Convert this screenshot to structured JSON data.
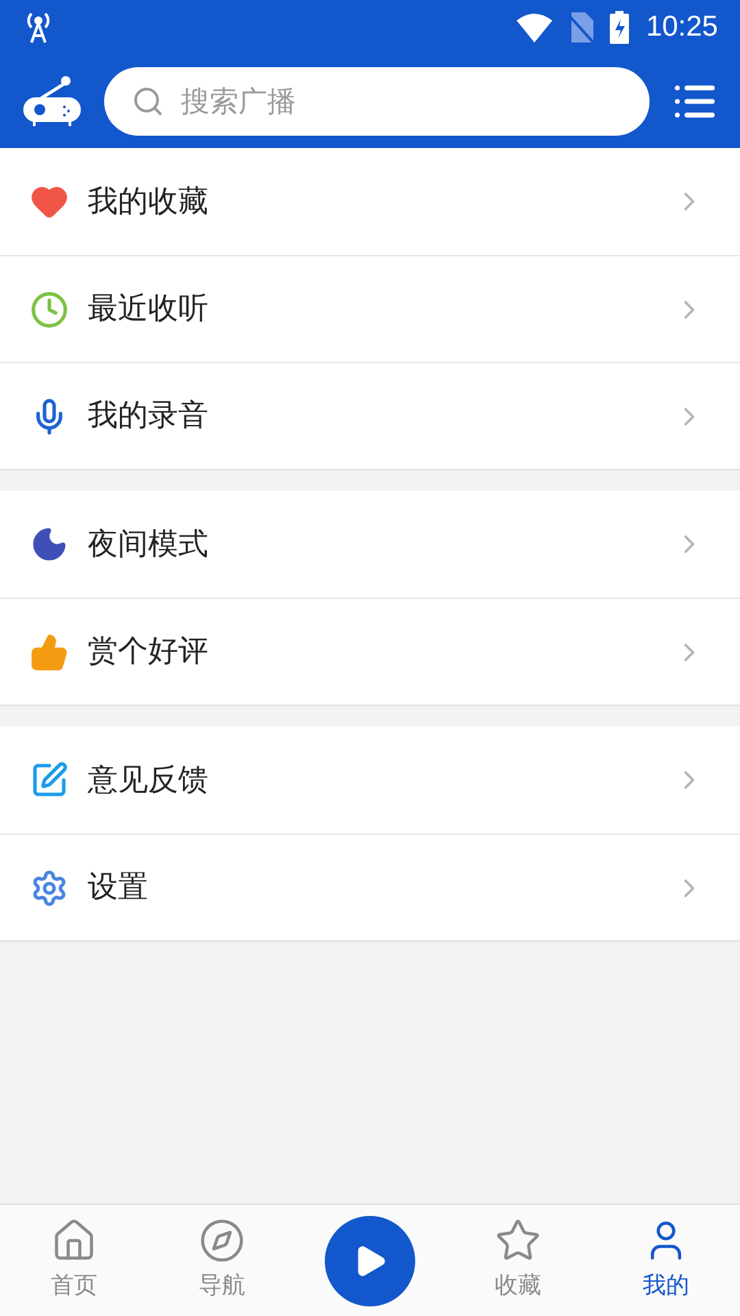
{
  "status_bar": {
    "time": "10:25"
  },
  "search": {
    "placeholder": "搜索广播"
  },
  "menu_groups": [
    {
      "items": [
        {
          "label": "我的收藏"
        },
        {
          "label": "最近收听"
        },
        {
          "label": "我的录音"
        }
      ]
    },
    {
      "items": [
        {
          "label": "夜间模式"
        },
        {
          "label": "赏个好评"
        }
      ]
    },
    {
      "items": [
        {
          "label": "意见反馈"
        },
        {
          "label": "设置"
        }
      ]
    }
  ],
  "bottom_nav": [
    {
      "kind": "tab",
      "label": "首页",
      "selected": false
    },
    {
      "kind": "tab",
      "label": "导航",
      "selected": false
    },
    {
      "kind": "play"
    },
    {
      "kind": "tab",
      "label": "收藏",
      "selected": false
    },
    {
      "kind": "tab",
      "label": "我的",
      "selected": true
    }
  ]
}
